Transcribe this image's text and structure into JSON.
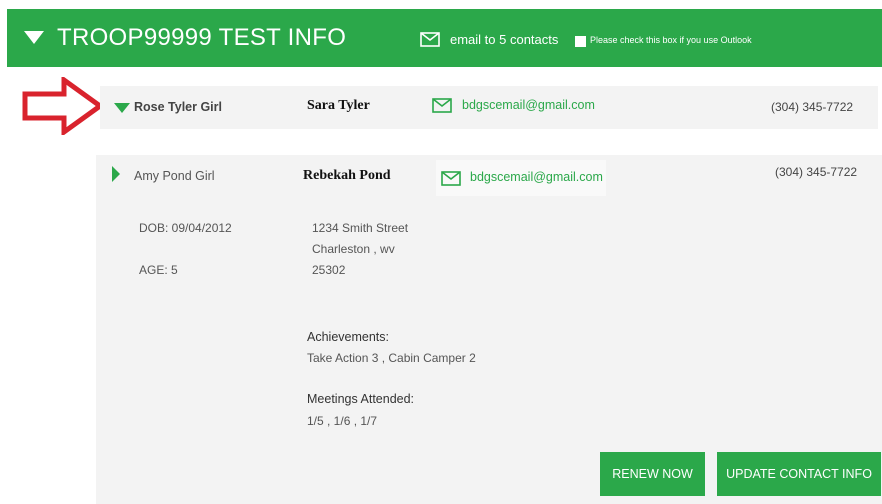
{
  "header": {
    "title": "TROOP99999 TEST INFO",
    "email_link": "email to 5 contacts",
    "outlook_checkbox_label": "Please check this box if you use Outlook"
  },
  "rows": [
    {
      "girl_name": "Rose Tyler Girl",
      "parent_name": "Sara Tyler",
      "email": "bdgscemail@gmail.com",
      "phone": "(304) 345-7722"
    },
    {
      "girl_name": "Amy Pond Girl",
      "parent_name": "Rebekah Pond",
      "email": "bdgscemail@gmail.com",
      "phone": "(304) 345-7722",
      "details": {
        "dob": "DOB: 09/04/2012",
        "age": "AGE: 5",
        "address_line1": "1234 Smith Street",
        "address_line2": "Charleston , wv",
        "address_line3": "25302",
        "achievements_heading": "Achievements:",
        "achievements_value": "Take Action 3 , Cabin Camper 2",
        "meetings_heading": "Meetings Attended:",
        "meetings_value": "1/5 , 1/6 , 1/7"
      },
      "buttons": {
        "renew": "RENEW NOW",
        "update": "UPDATE CONTACT INFO"
      }
    }
  ],
  "colors": {
    "accent": "#2ba84a",
    "annotation_arrow": "#d9232d",
    "row_background": "#f3f3f3"
  },
  "icons": {
    "header_caret": "caret-down-icon",
    "mail": "mail-icon",
    "annotation": "red-outline-arrow-icon"
  }
}
